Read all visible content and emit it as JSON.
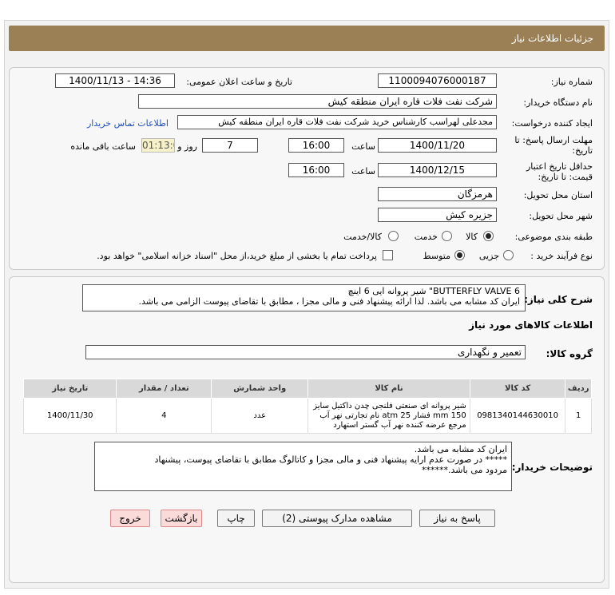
{
  "header": {
    "title": "جزئیات اطلاعات نیاز"
  },
  "form": {
    "need_number_label": "شماره نیاز:",
    "need_number": "1100094076000187",
    "announce_label": "تاریخ و ساعت اعلان عمومی:",
    "announce_value": "1400/11/13 - 14:36",
    "buyer_org_label": "نام دستگاه خریدار:",
    "buyer_org": "شرکت نفت فلات قاره ایران منطقه کیش",
    "creator_label": "ایجاد کننده درخواست:",
    "creator": "مجدعلی لهراسب کارشناس خرید شرکت نفت فلات قاره ایران منطقه کیش",
    "contact_link": "اطلاعات تماس خریدار",
    "send_deadline_label_1": "مهلت ارسال پاسخ: تا",
    "send_deadline_label_2": "تاریخ:",
    "send_date": "1400/11/20",
    "time_label": "ساعت",
    "send_time": "16:00",
    "days_value": "7",
    "days_label": "روز و",
    "remaining_time": "01:13:06",
    "remaining_label": "ساعت باقی مانده",
    "price_validity_label_1": "حداقل تاریخ اعتبار",
    "price_validity_label_2": "قیمت: تا تاریخ:",
    "price_date": "1400/12/15",
    "price_time": "16:00",
    "province_label": "استان محل تحویل:",
    "province": "هرمزگان",
    "city_label": "شهر محل تحویل:",
    "city": "جزیره کیش",
    "category_label": "طبقه بندی موضوعی:",
    "category_options": [
      "کالا",
      "خدمت",
      "کالا/خدمت"
    ],
    "process_label": "نوع فرآیند خرید :",
    "process_options": [
      "جزیی",
      "متوسط"
    ],
    "treasury_note": "پرداخت تمام یا بخشی از مبلغ خرید،از محل \"اسناد خزانه اسلامی\" خواهد بود."
  },
  "summary": {
    "label": "شرح کلی نیاز:",
    "line1": "BUTTERFLY VALVE 6\" شیر پروانه ایی 6 اینچ",
    "line2": "ایران کد مشابه می باشد. لذا ارائه پیشنهاد فنی و مالی مجزا ، مطابق با تقاضای پیوست الزامی می باشد."
  },
  "goods": {
    "section_title": "اطلاعات کالاهای مورد نیاز",
    "group_label": "گروه کالا:",
    "group_value": "تعمیر و نگهداری",
    "columns": [
      "ردیف",
      "کد کالا",
      "نام کالا",
      "واحد شمارش",
      "تعداد / مقدار",
      "تاریخ نیاز"
    ],
    "rows": [
      {
        "row": "1",
        "code": "0981340144630010",
        "name": "شیر پروانه ای صنعتی فلنجی چدن داکتیل سایز mm 150 فشار atm 25 نام تجارتی نهر آب مرجع عرضه کننده نهر آب گستر استهارد",
        "unit": "عدد",
        "qty": "4",
        "date": "1400/11/30"
      }
    ]
  },
  "buyer_notes": {
    "label": "توضیحات خریدار:",
    "line1": "ایران کد مشابه می باشد.",
    "line2": "***** در صورت عدم ارایه پیشنهاد فنی و مالی مجزا و کاتالوگ مطابق با تقاضای پیوست، پیشنهاد",
    "line3": "مردود می باشد.******"
  },
  "buttons": {
    "reply": "پاسخ به نیاز",
    "attachments": "مشاهده مدارک پیوستی (2)",
    "print": "چاپ",
    "back": "بازگشت",
    "exit": "خروج"
  }
}
